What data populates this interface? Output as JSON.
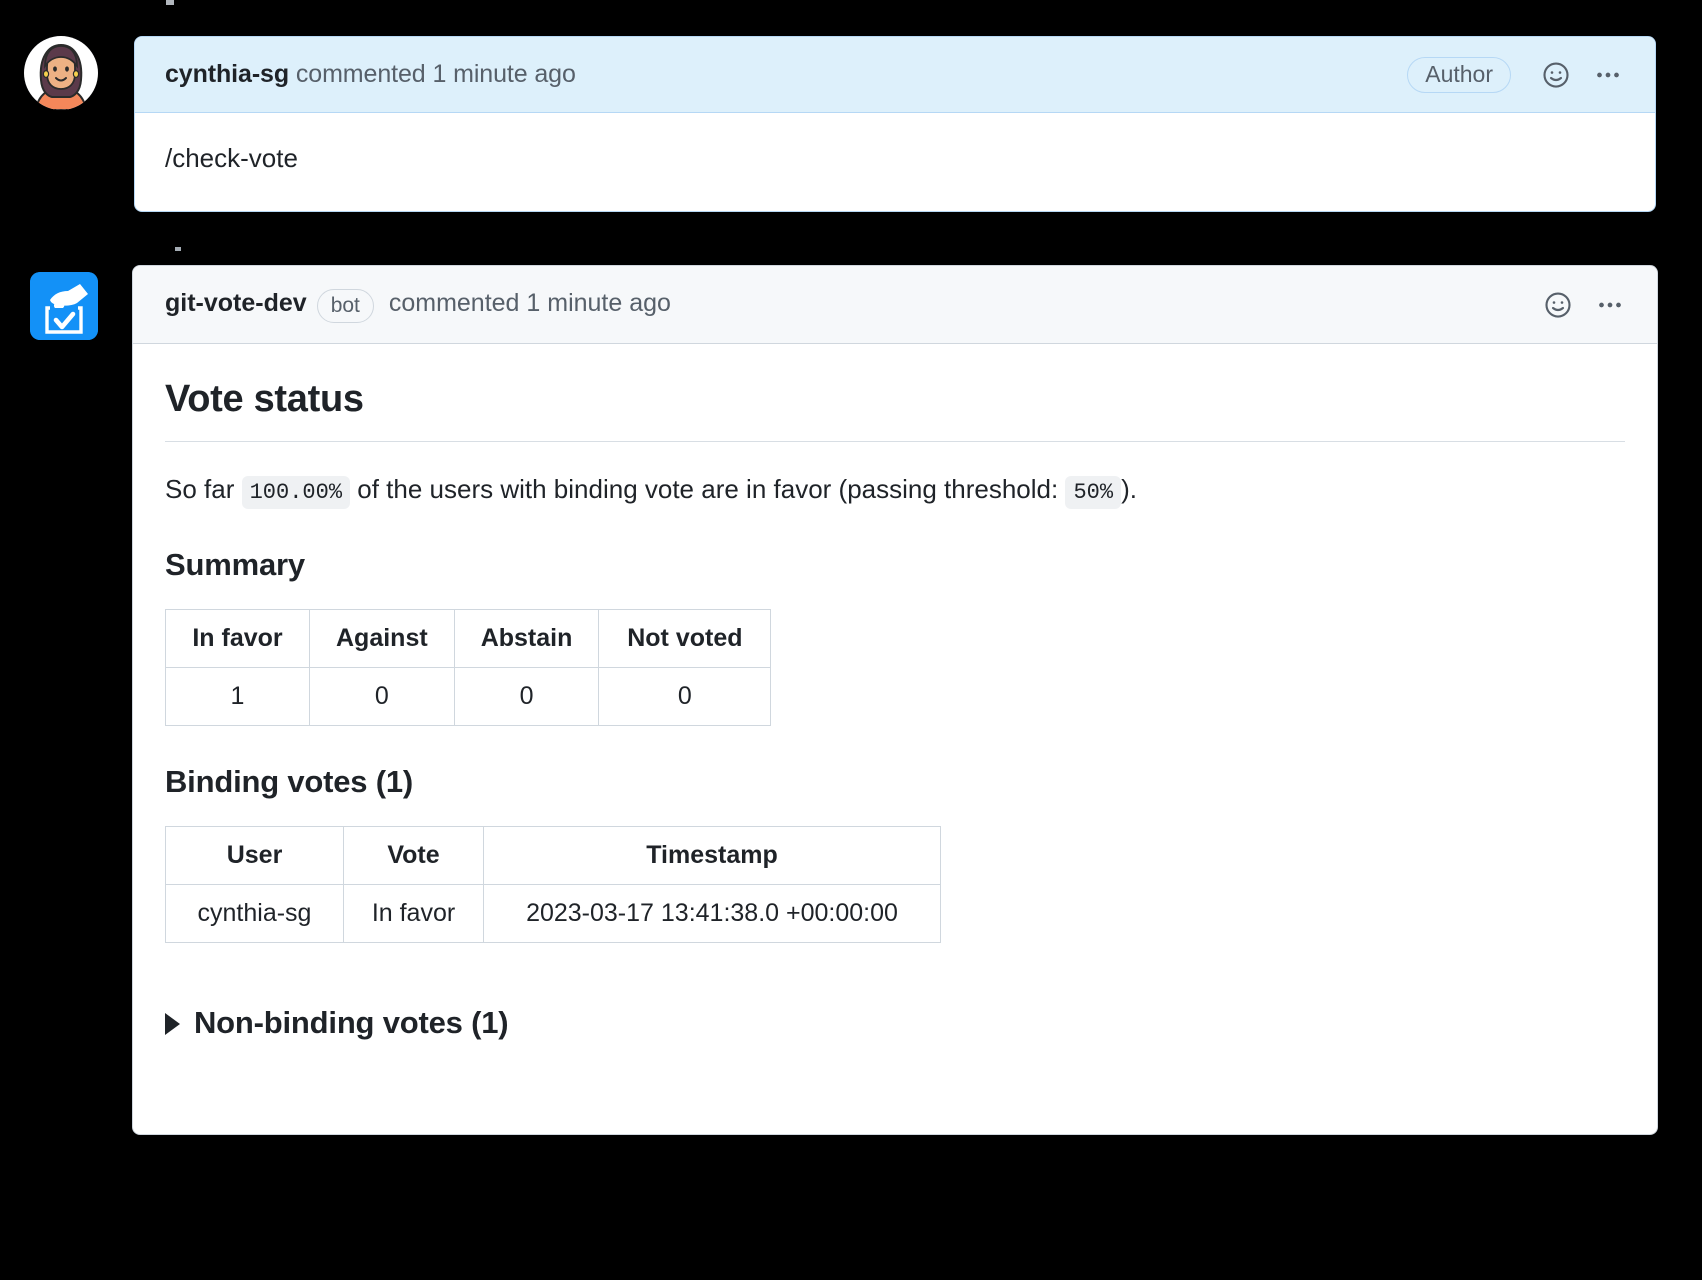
{
  "artifacts": {
    "top_strip": "",
    "mid_dot": ""
  },
  "comments": [
    {
      "author": "cynthia-sg",
      "meta": " commented 1 minute ago",
      "badge": "Author",
      "avatar_icon": "user-avatar-woman",
      "reaction_icon": "smiley-plus-icon",
      "menu_icon": "kebab-menu-icon",
      "body_text": "/check-vote",
      "header_bg": "#ddf0fb",
      "border": "#b6d8f5"
    },
    {
      "author": "git-vote-dev",
      "bot_label": "bot",
      "meta": " commented 1 minute ago",
      "avatar_icon": "ballot-box-hand-icon",
      "reaction_icon": "smiley-plus-icon",
      "menu_icon": "kebab-menu-icon",
      "header_bg": "#f6f8fa",
      "border": "#d0d7de"
    }
  ],
  "report": {
    "title": "Vote status",
    "status_sentence": {
      "prefix": "So far",
      "percent": "100.00%",
      "middle": "of the users with binding vote are in favor (passing threshold:",
      "threshold": "50%",
      "suffix": ").",
      "full": "So far 100.00% of the users with binding vote are in favor (passing threshold: 50% )."
    },
    "summary": {
      "heading": "Summary",
      "columns": [
        "In favor",
        "Against",
        "Abstain",
        "Not voted"
      ],
      "rows": [
        [
          "1",
          "0",
          "0",
          "0"
        ]
      ]
    },
    "binding": {
      "heading": "Binding votes (1)",
      "columns": [
        "User",
        "Vote",
        "Timestamp"
      ],
      "rows": [
        [
          "cynthia-sg",
          "In favor",
          "2023-03-17 13:41:38.0 +00:00:00"
        ]
      ]
    },
    "non_binding": {
      "heading": "Non-binding votes (1)",
      "expanded": false,
      "disclosure_icon": "triangle-right-icon"
    }
  },
  "chart_data": {
    "type": "table",
    "title": "Vote status",
    "summary_categories": [
      "In favor",
      "Against",
      "Abstain",
      "Not voted"
    ],
    "summary_values": [
      1,
      0,
      0,
      0
    ],
    "percent_in_favor": 100.0,
    "passing_threshold_percent": 50,
    "binding_vote_count": 1,
    "non_binding_vote_count": 1
  }
}
